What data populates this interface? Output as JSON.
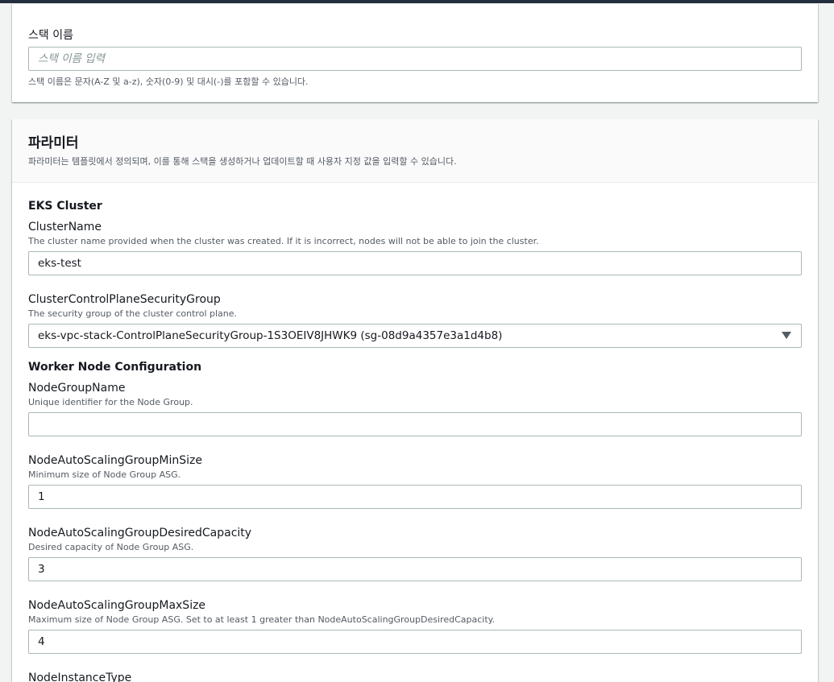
{
  "stack_name": {
    "label": "스택 이름",
    "placeholder": "스택 이름 입력",
    "value": "",
    "hint": "스택 이름은 문자(A-Z 및 a-z), 숫자(0-9) 및 대시(-)를 포함할 수 있습니다."
  },
  "parameters": {
    "title": "파라미터",
    "description": "파라미터는 템플릿에서 정의되며, 이를 통해 스택을 생성하거나 업데이트할 때 사용자 지정 값을 입력할 수 있습니다.",
    "eks_group": "EKS Cluster",
    "worker_group": "Worker Node Configuration",
    "fields": [
      {
        "label": "ClusterName",
        "description": "The cluster name provided when the cluster was created. If it is incorrect, nodes will not be able to join the cluster.",
        "value": "eks-test"
      },
      {
        "label": "ClusterControlPlaneSecurityGroup",
        "description": "The security group of the cluster control plane.",
        "value": "eks-vpc-stack-ControlPlaneSecurityGroup-1S3OEIV8JHWK9 (sg-08d9a4357e3a1d4b8)"
      },
      {
        "label": "NodeGroupName",
        "description": "Unique identifier for the Node Group.",
        "value": ""
      },
      {
        "label": "NodeAutoScalingGroupMinSize",
        "description": "Minimum size of Node Group ASG.",
        "value": "1"
      },
      {
        "label": "NodeAutoScalingGroupDesiredCapacity",
        "description": "Desired capacity of Node Group ASG.",
        "value": "3"
      },
      {
        "label": "NodeAutoScalingGroupMaxSize",
        "description": "Maximum size of Node Group ASG. Set to at least 1 greater than NodeAutoScalingGroupDesiredCapacity.",
        "value": "4"
      },
      {
        "label": "NodeInstanceType"
      }
    ]
  },
  "icons": {
    "dropdown": "caret-down-icon"
  },
  "colors": {
    "page_bg": "#f2f3f3",
    "top_bar": "#232f3e",
    "input_border": "#aab7b8",
    "description_text": "#545b64"
  }
}
